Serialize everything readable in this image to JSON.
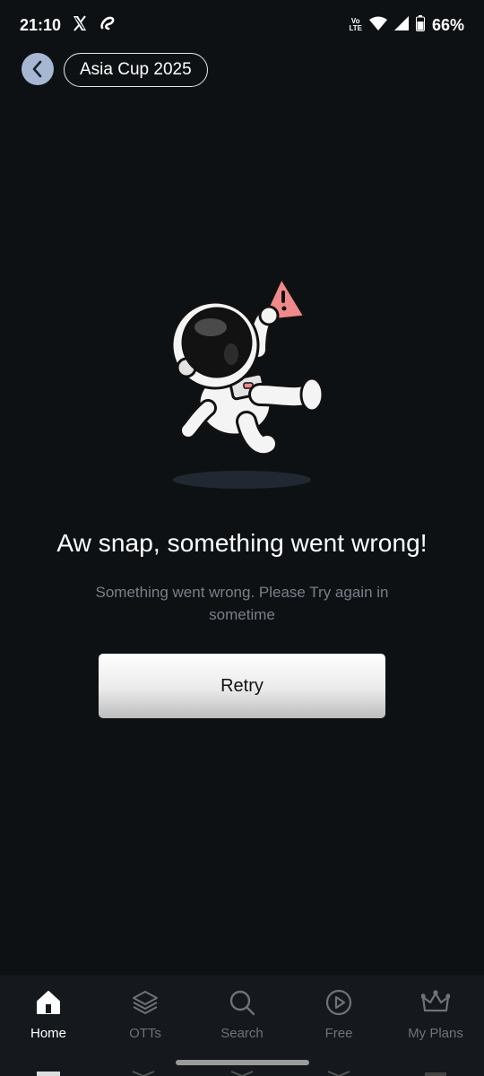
{
  "status_bar": {
    "time": "21:10",
    "battery": "66%",
    "network_label_top": "Vo",
    "network_label_bottom": "LTE"
  },
  "header": {
    "title": "Asia Cup 2025"
  },
  "error": {
    "title": "Aw snap, something went wrong!",
    "subtitle": "Something went wrong. Please Try again in sometime",
    "retry_label": "Retry"
  },
  "bottom_nav": {
    "items": [
      {
        "label": "Home",
        "icon": "home-icon",
        "active": true
      },
      {
        "label": "OTTs",
        "icon": "layers-icon",
        "active": false
      },
      {
        "label": "Search",
        "icon": "search-icon",
        "active": false
      },
      {
        "label": "Free",
        "icon": "play-circle-icon",
        "active": false
      },
      {
        "label": "My Plans",
        "icon": "crown-icon",
        "active": false
      }
    ]
  },
  "colors": {
    "background": "#0e1114",
    "back_button": "#a6b7d3",
    "warning_sign": "#f08a8a",
    "nav_background": "#15191e"
  }
}
